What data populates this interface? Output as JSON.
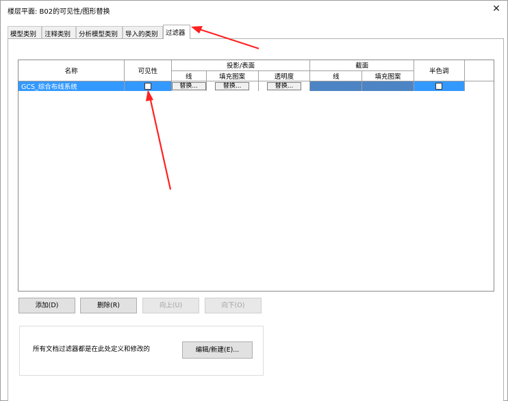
{
  "window": {
    "title": "楼层平面: B02的可见性/图形替换",
    "close_symbol": "✕"
  },
  "tabs": [
    {
      "label": "模型类别"
    },
    {
      "label": "注释类别"
    },
    {
      "label": "分析模型类别"
    },
    {
      "label": "导入的类别"
    },
    {
      "label": "过滤器",
      "active": true
    }
  ],
  "grid": {
    "headers": {
      "name": "名称",
      "visibility": "可见性",
      "projection_group": "投影/表面",
      "projection_line": "线",
      "projection_fill": "填充图案",
      "projection_transparency": "透明度",
      "cut_group": "截面",
      "cut_line": "线",
      "cut_fill": "填充图案",
      "halftone": "半色调"
    },
    "rows": [
      {
        "name": "GCS_综合布线系统",
        "visible": false,
        "proj_line_btn": "替换...",
        "proj_fill_btn": "替换...",
        "proj_transparency_btn": "替换...",
        "halftone": false
      }
    ]
  },
  "buttons": {
    "add": "添加(D)",
    "delete": "删除(R)",
    "up": "向上(U)",
    "down": "向下(O)"
  },
  "info": {
    "text": "所有文档过滤器都是在此处定义和修改的",
    "edit_button": "编辑/新建(E)..."
  },
  "colors": {
    "selection": "#3399ff",
    "annotation_arrow": "#ff0000"
  }
}
